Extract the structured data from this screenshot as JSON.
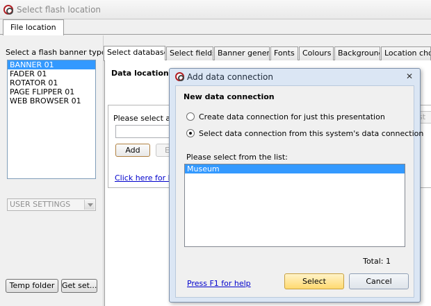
{
  "window": {
    "title": "Select flash location"
  },
  "top_tabs": [
    {
      "label": "File location"
    }
  ],
  "left_panel": {
    "label": "Select a flash banner type",
    "banners": [
      "BANNER 01",
      "FADER 01",
      "ROTATOR 01",
      "PAGE FLIPPER 01",
      "WEB BROWSER 01"
    ],
    "selected_index": 0,
    "user_settings": "USER SETTINGS",
    "temp_folder": "Temp folder",
    "get_settings": "Get set..."
  },
  "inner_tabs": [
    "Select database",
    "Select fields",
    "Banner general",
    "Fonts",
    "Colours",
    "Background",
    "Location cho"
  ],
  "content": {
    "data_location": "Data location",
    "prompt": "Please select a d",
    "add": "Add",
    "edit_partial": "E",
    "link": "Click here for he",
    "ghost_button": "st"
  },
  "dialog": {
    "title": "Add data connection",
    "heading": "New data connection",
    "radio_1": "Create data connection for just this presentation",
    "radio_2": "Select data connection from this system's data connection",
    "selected_radio": 2,
    "list_label": "Please select from the list:",
    "connections": [
      "Museum"
    ],
    "total": "Total: 1",
    "help_link": "Press F1 for help",
    "select": "Select",
    "cancel": "Cancel"
  }
}
